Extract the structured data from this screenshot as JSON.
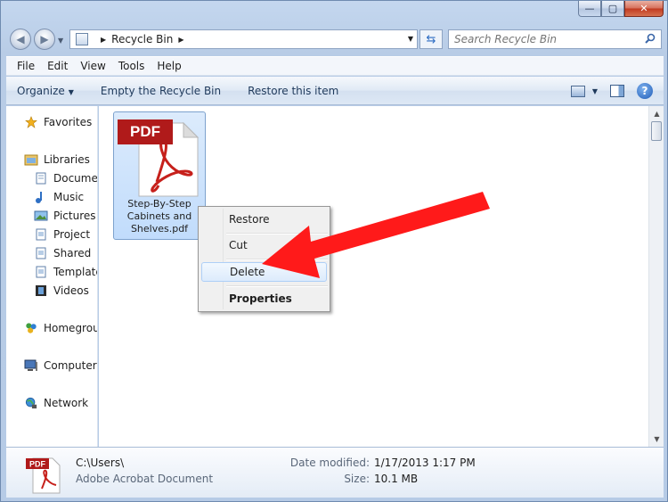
{
  "window": {
    "minimize_glyph": "—",
    "maximize_glyph": "▢",
    "close_glyph": "✕"
  },
  "address": {
    "location": "Recycle Bin",
    "search_placeholder": "Search Recycle Bin"
  },
  "menubar": [
    "File",
    "Edit",
    "View",
    "Tools",
    "Help"
  ],
  "commands": {
    "organize": "Organize",
    "empty": "Empty the Recycle Bin",
    "restore": "Restore this item"
  },
  "nav": {
    "favorites": "Favorites",
    "libraries": "Libraries",
    "documents": "Documents",
    "music": "Music",
    "pictures": "Pictures",
    "project": "Project",
    "shared": "Shared",
    "templates": "Templates",
    "videos": "Videos",
    "homegroup": "Homegroup",
    "computer": "Computer",
    "network": "Network"
  },
  "file": {
    "badge": "PDF",
    "name_lines": [
      "Step-By-Step",
      "Cabinets and",
      "Shelves.pdf"
    ]
  },
  "context_menu": {
    "restore": "Restore",
    "cut": "Cut",
    "delete": "Delete",
    "properties": "Properties"
  },
  "details": {
    "path": "C:\\Users\\",
    "type": "Adobe Acrobat Document",
    "date_label": "Date modified:",
    "date_value": "1/17/2013 1:17 PM",
    "size_label": "Size:",
    "size_value": "10.1 MB"
  },
  "colors": {
    "annotation_arrow": "#ff1a1a",
    "pdf_badge": "#b01a1a",
    "selection": "#c1dcfc"
  }
}
